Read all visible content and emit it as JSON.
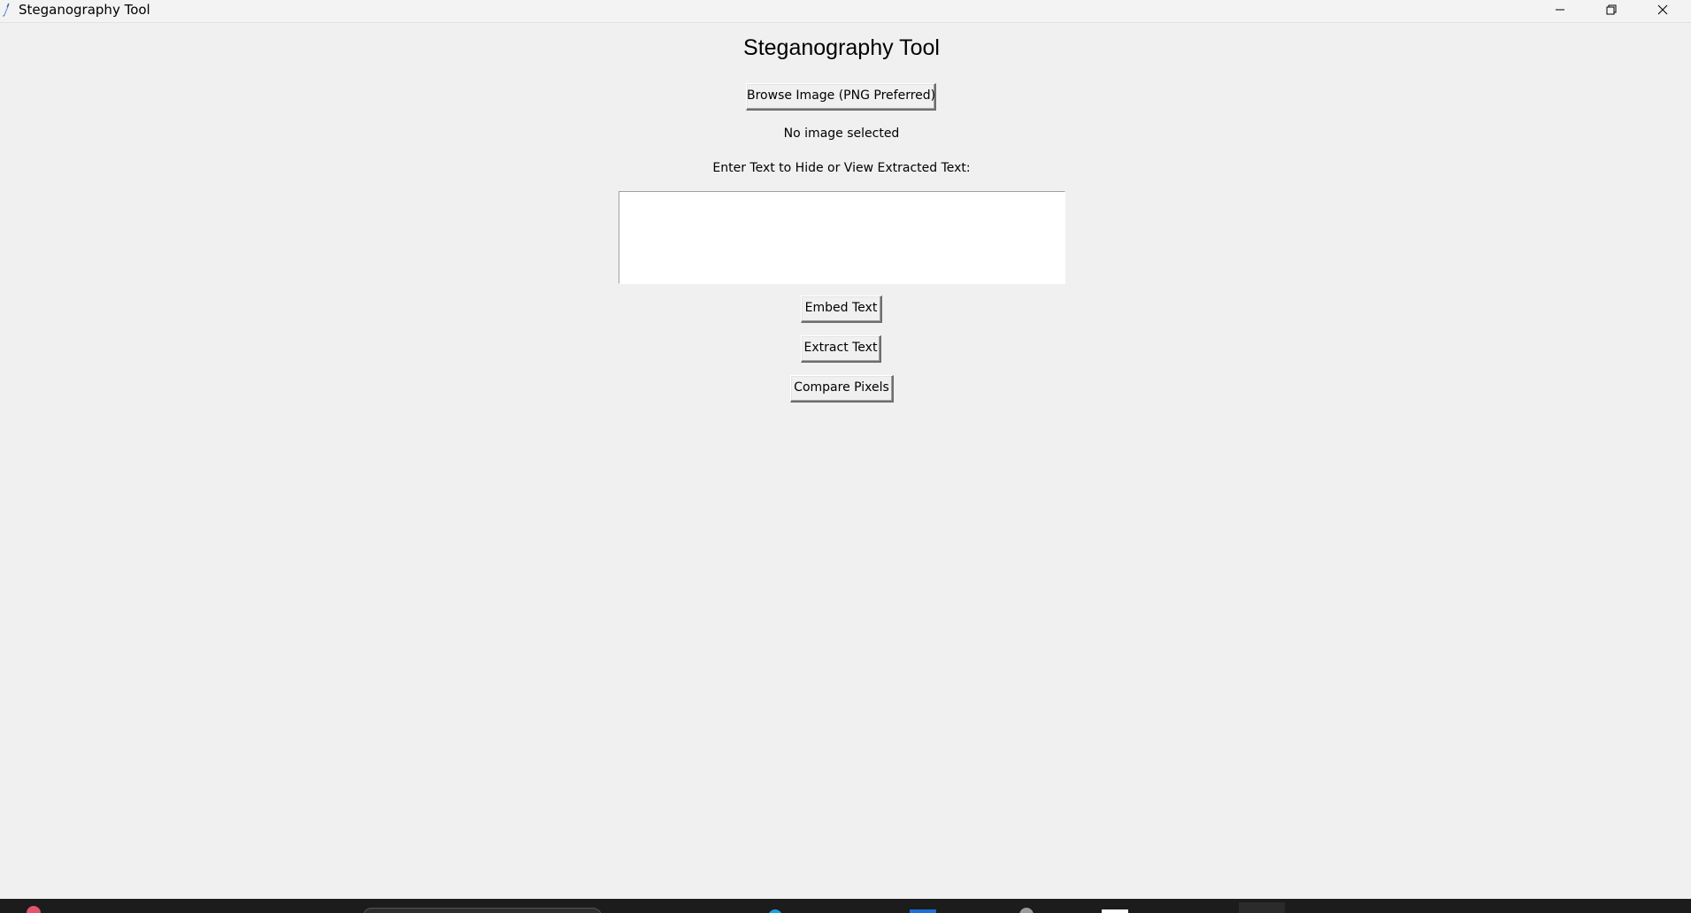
{
  "window": {
    "title": "Steganography Tool"
  },
  "main": {
    "heading": "Steganography Tool",
    "browse_button_label": "Browse Image (PNG Preferred)",
    "status_text": "No image selected",
    "prompt_label": "Enter Text to Hide or View Extracted Text:",
    "text_area_value": "",
    "embed_button_label": "Embed Text",
    "extract_button_label": "Extract Text",
    "compare_button_label": "Compare Pixels"
  },
  "icons": {
    "app": "feather-icon",
    "minimize": "minimize-icon",
    "maximize": "restore-icon",
    "close": "close-icon"
  },
  "colors": {
    "window_bg": "#f0f0f0",
    "taskbar_bg": "#1c1c1c"
  }
}
